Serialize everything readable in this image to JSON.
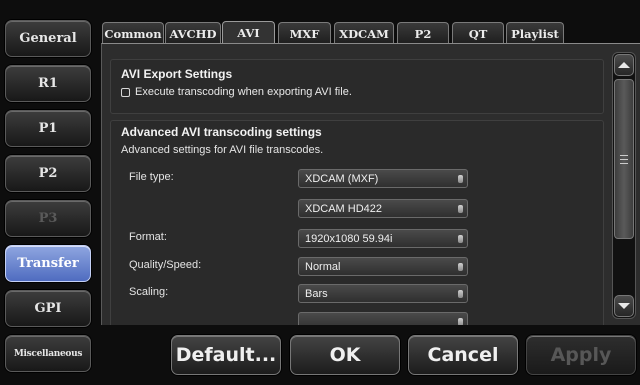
{
  "sidebar": {
    "items": [
      {
        "label": "General"
      },
      {
        "label": "R1"
      },
      {
        "label": "P1"
      },
      {
        "label": "P2"
      },
      {
        "label": "P3"
      },
      {
        "label": "Transfer"
      },
      {
        "label": "GPI"
      },
      {
        "label": "Miscellaneous"
      }
    ],
    "active": "Transfer",
    "disabled": [
      "P3"
    ]
  },
  "tabs": [
    {
      "label": "Common"
    },
    {
      "label": "AVCHD"
    },
    {
      "label": "AVI"
    },
    {
      "label": "MXF"
    },
    {
      "label": "XDCAM"
    },
    {
      "label": "P2"
    },
    {
      "label": "QT"
    },
    {
      "label": "Playlist"
    }
  ],
  "active_tab": "AVI",
  "export_settings": {
    "title": "AVI Export Settings",
    "checkbox_label": "Execute transcoding when exporting AVI file.",
    "checked": false
  },
  "advanced": {
    "title": "Advanced AVI transcoding settings",
    "description": "Advanced settings for AVI file transcodes.",
    "file_type_label": "File type:",
    "file_type_value": "XDCAM (MXF)",
    "file_subtype_value": "XDCAM HD422",
    "format_label": "Format:",
    "format_value": "1920x1080 59.94i",
    "quality_label": "Quality/Speed:",
    "quality_value": "Normal",
    "scaling_label": "Scaling:",
    "scaling_value": "Bars"
  },
  "buttons": {
    "default": "Default...",
    "ok": "OK",
    "cancel": "Cancel",
    "apply": "Apply"
  },
  "colors": {
    "active_sidebar": "#5f7ccc",
    "background": "#0d0d0d",
    "panel": "#2d2d2d"
  }
}
